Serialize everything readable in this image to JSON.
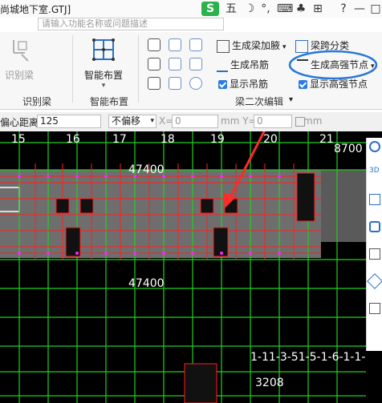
{
  "titlebar": {
    "title": "尚城地下室.GTJ]",
    "search_placeholder": "请输入功能名称或问题描述",
    "ime_badge": "S",
    "ime_mode": "五",
    "question": "?",
    "minimize": "—",
    "restore": "□"
  },
  "ribbon": {
    "groups": [
      {
        "label": "识别梁"
      },
      {
        "label": "智能布置"
      },
      {
        "label": "梁二次编辑"
      }
    ],
    "identify_beam_label": "识别梁",
    "smart_layout_label": "智能布置",
    "buttons": {
      "gen_haunch": "生成梁加腋",
      "beam_span": "梁跨分类",
      "gen_hanger": "生成吊筋",
      "gen_high_strength": "生成高强节点",
      "show_hanger": "显示吊筋",
      "show_high_strength": "显示高强节点"
    }
  },
  "propbar": {
    "offset_label": "偏心距离:",
    "offset_value": "125",
    "offset_mode": "不偏移",
    "x_label": "X=",
    "x_value": "0",
    "y_label": "mm Y=",
    "y_value": "0",
    "unit": "mm"
  },
  "canvas": {
    "top_labels": [
      "15",
      "16",
      "17",
      "18",
      "19",
      "20",
      "21",
      "8700"
    ],
    "dimension_text": "47400",
    "dimension_text_2": "47400",
    "span_text": "1-11-3-51-5-1-6-1-1-",
    "bottom_text": "3208"
  },
  "colors": {
    "canvas_bg": "#000000",
    "gray_slab": "#707070",
    "red_lines": "#ff2020",
    "green_lines": "#20d020",
    "magenta": "#ff20ff",
    "annotation": "#2878d8",
    "accent": "#2d7be6"
  }
}
